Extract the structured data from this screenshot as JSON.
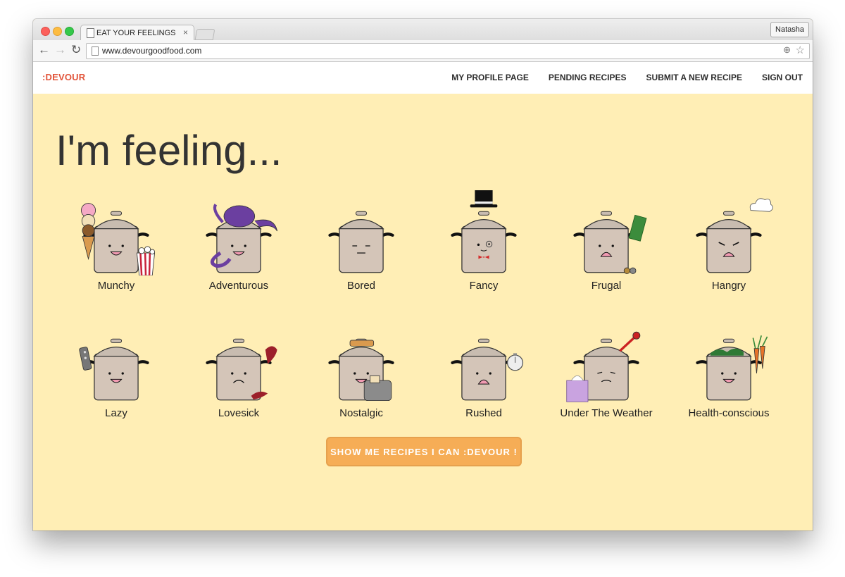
{
  "browser": {
    "tab_title": "EAT YOUR FEELINGS",
    "tab_close": "×",
    "profile_name": "Natasha",
    "url": "www.devourgoodfood.com",
    "back": "←",
    "forward": "→",
    "reload": "↻",
    "zoom": "⊕",
    "star": "☆"
  },
  "site": {
    "brand": ":DEVOUR",
    "nav": [
      "MY PROFILE PAGE",
      "PENDING RECIPES",
      "SUBMIT A NEW RECIPE",
      "SIGN OUT"
    ]
  },
  "main": {
    "heading": "I'm feeling...",
    "moods": [
      {
        "label": "Munchy",
        "face": "happy",
        "prop": "ice-cream-popcorn"
      },
      {
        "label": "Adventurous",
        "face": "happy",
        "prop": "octopus"
      },
      {
        "label": "Bored",
        "face": "bored",
        "prop": "none"
      },
      {
        "label": "Fancy",
        "face": "monocle",
        "prop": "top-hat"
      },
      {
        "label": "Frugal",
        "face": "worried",
        "prop": "money"
      },
      {
        "label": "Hangry",
        "face": "angry",
        "prop": "steam"
      },
      {
        "label": "Lazy",
        "face": "happy",
        "prop": "remote"
      },
      {
        "label": "Lovesick",
        "face": "sad",
        "prop": "broken-heart"
      },
      {
        "label": "Nostalgic",
        "face": "happy",
        "prop": "toaster"
      },
      {
        "label": "Rushed",
        "face": "worried",
        "prop": "stopwatch"
      },
      {
        "label": "Under The Weather",
        "face": "sick",
        "prop": "tissues-thermometer"
      },
      {
        "label": "Health-conscious",
        "face": "happy",
        "prop": "carrots"
      }
    ],
    "cta": "SHOW ME RECIPES I CAN :DEVOUR !"
  },
  "colors": {
    "background": "#ffeeb5",
    "brand": "#e2553b",
    "button": "#f6ad56",
    "pot": "#d4c5b8"
  }
}
